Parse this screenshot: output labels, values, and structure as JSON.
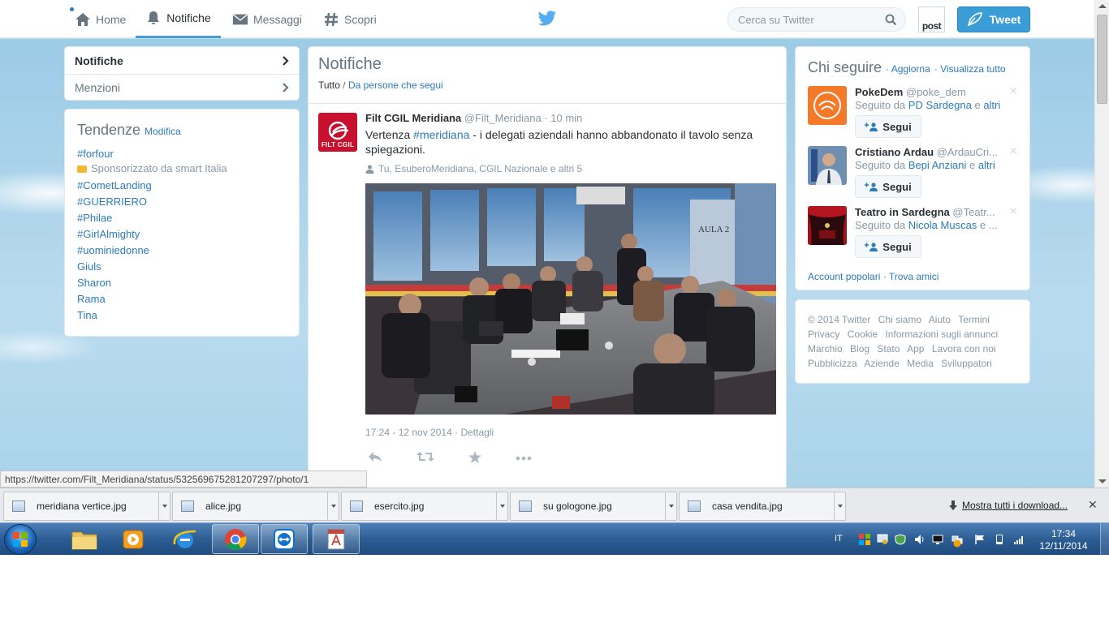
{
  "topnav": {
    "home": "Home",
    "notifications": "Notifiche",
    "messages": "Messaggi",
    "discover": "Scopri",
    "search_placeholder": "Cerca su Twitter",
    "avatar_label": "post",
    "tweet_button": "Tweet"
  },
  "leftnav": {
    "items": [
      {
        "label": "Notifiche"
      },
      {
        "label": "Menzioni"
      }
    ]
  },
  "trends": {
    "title": "Tendenze",
    "edit": "Modifica",
    "items": [
      "#forfour",
      "#CometLanding",
      "#GUERRIERO",
      "#Philae",
      "#GirlAlmighty",
      "#uominiedonne",
      "Giuls",
      "Sharon",
      "Rama",
      "Tina"
    ],
    "promoted": "Sponsorizzato da smart Italia"
  },
  "main": {
    "title": "Notifiche",
    "filter_all": "Tutto",
    "filter_sep": "/",
    "filter_following": "Da persone che segui",
    "tweet": {
      "avatar_text": "FILT CGIL",
      "name": "Filt CGIL Meridiana",
      "handle": "@Filt_Meridiana",
      "time": "· 10 min",
      "text_pre": "Vertenza ",
      "hashtag": "#meridiana",
      "text_post": " - i delegati aziendali hanno abbandonato il tavolo senza spiegazioni.",
      "context": "Tu, EsuberoMeridiana, CGIL Nazionale e altri 5",
      "photo_sign": "AULA 2",
      "timestamp": "17:24 - 12 nov 2014",
      "details": "Dettagli"
    }
  },
  "who_to_follow": {
    "title": "Chi seguire",
    "refresh": "· Aggiorna",
    "view_all": "· Visualizza tutto",
    "follow_label": "Segui",
    "followed_by_prefix": "Seguito da ",
    "suggestions": [
      {
        "name": "PokeDem",
        "handle": "@poke_dem",
        "by": "PD Sardegna",
        "sep": " e ",
        "more": "altri"
      },
      {
        "name": "Cristiano Ardau",
        "handle": "@ArdauCri...",
        "by": "Bepi Anziani",
        "sep": " e ",
        "more": "altri"
      },
      {
        "name": "Teatro in Sardegna",
        "handle": "@Teatr...",
        "by": "Nicola Muscas",
        "sep": " e ",
        "more": "..."
      }
    ],
    "popular": "Account popolari",
    "find_friends": "· Trova amici"
  },
  "footer": {
    "links": [
      "© 2014 Twitter",
      "Chi siamo",
      "Aiuto",
      "Termini",
      "Privacy",
      "Cookie",
      "Informazioni sugli annunci",
      "Marchio",
      "Blog",
      "Stato",
      "App",
      "Lavora con noi",
      "Pubblicizza",
      "Aziende",
      "Media",
      "Sviluppatori"
    ]
  },
  "status_url": "https://twitter.com/Filt_Meridiana/status/532569675281207297/photo/1",
  "downloads": {
    "items": [
      "meridiana vertice.jpg",
      "alice.jpg",
      "esercito.jpg",
      "su gologone.jpg",
      "casa vendita.jpg"
    ],
    "show_all": "Mostra tutti i download..."
  },
  "taskbar": {
    "lang": "IT",
    "time": "17:34",
    "date": "12/11/2014"
  },
  "colors": {
    "accent": "#2b7bb9",
    "tweet_button": "#3a9dd6",
    "brand_red": "#c8102e"
  }
}
